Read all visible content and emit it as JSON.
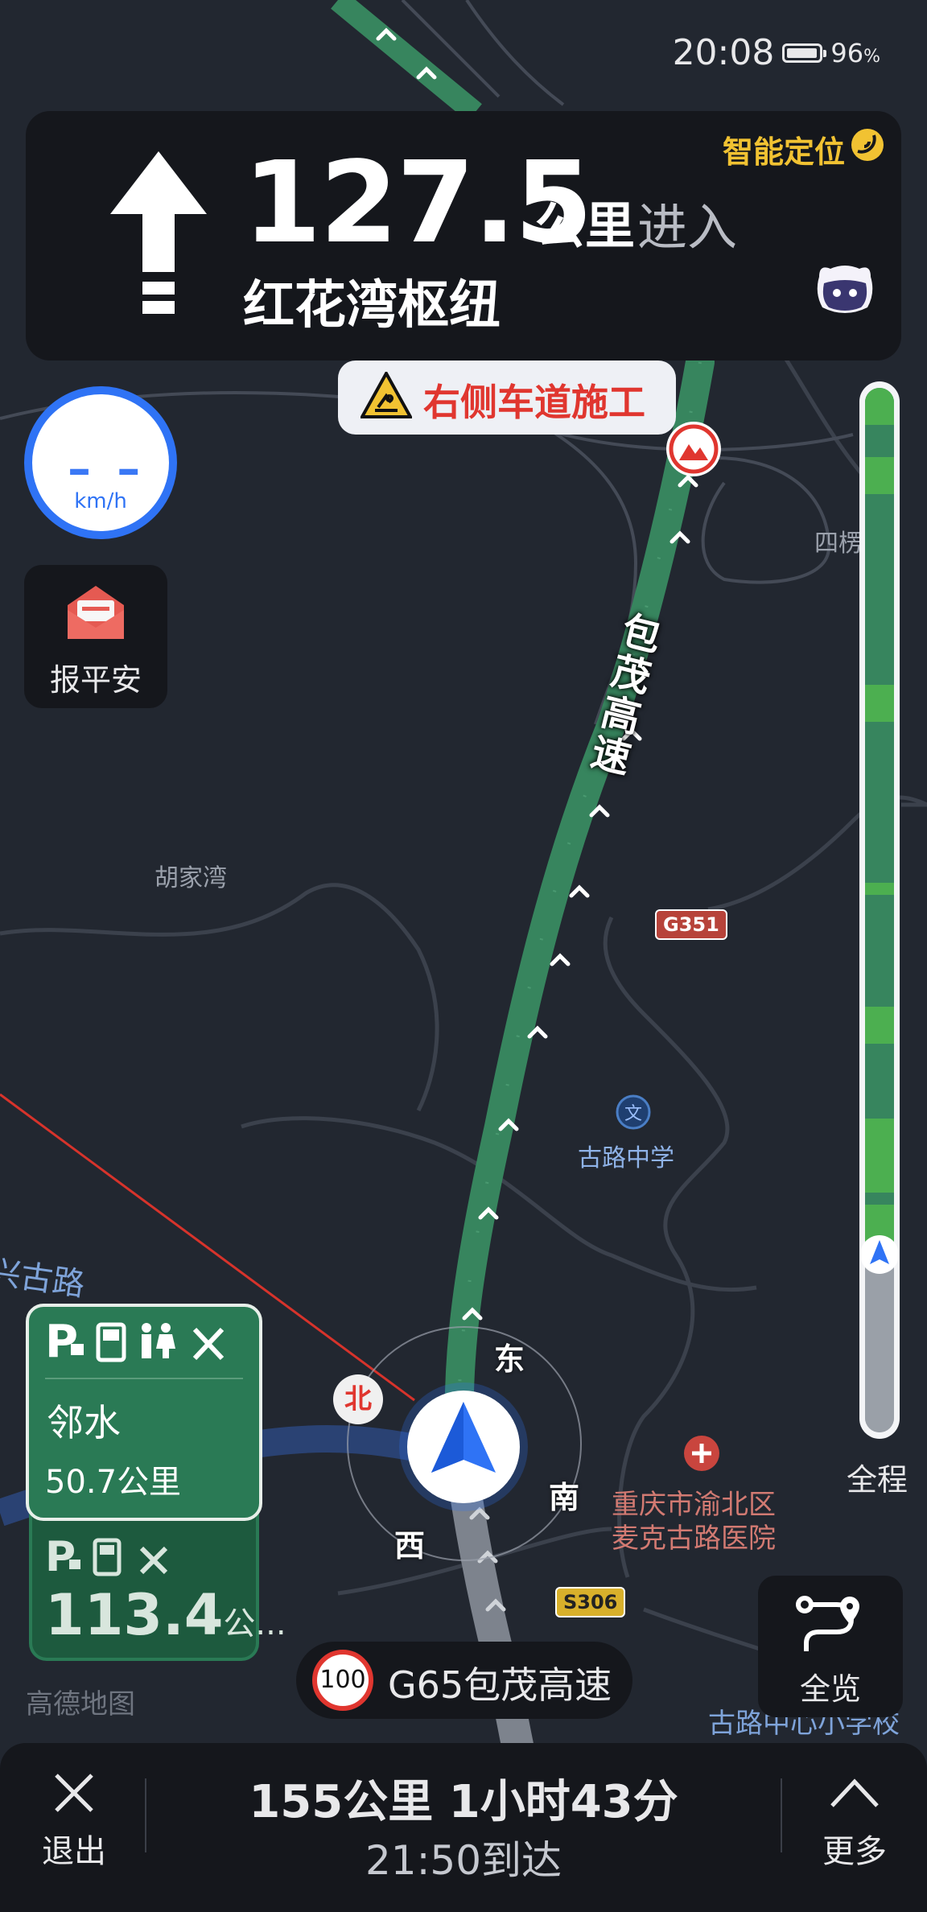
{
  "status_bar": {
    "time": "20:08",
    "battery_percent": "96",
    "battery_unit": "%",
    "battery_level": 0.96
  },
  "guidance": {
    "distance": "127.5",
    "distance_unit": "公里",
    "action": "进入",
    "road": "红花湾枢纽",
    "smart_location": "智能定位",
    "maneuver_icon": "straight-arrow-icon"
  },
  "warning": {
    "text": "右侧车道施工",
    "icon": "construction-icon"
  },
  "speedometer": {
    "value": "– –",
    "unit": "km/h"
  },
  "safety_button": {
    "label": "报平安",
    "icon": "envelope-icon"
  },
  "progress": {
    "label": "全程",
    "traveled_fraction": 0.17,
    "colors": {
      "smooth": "#4caf50",
      "fast": "#37855e",
      "traveled": "#9aa0a8"
    }
  },
  "service_areas": [
    {
      "name": "邻水",
      "distance": "50.7",
      "unit": "公里",
      "icons": [
        "parking-icon",
        "fuel-icon",
        "restroom-icon",
        "repair-icon"
      ]
    },
    {
      "distance": "113.4",
      "unit": "公...",
      "icons": [
        "parking-icon",
        "fuel-icon",
        "repair-icon"
      ]
    }
  ],
  "brand": "高德地图",
  "overview_button": {
    "label": "全览",
    "icon": "route-icon"
  },
  "current_road": {
    "speed_limit": "100",
    "name": "G65包茂高速"
  },
  "bottom_bar": {
    "exit_label": "退出",
    "more_label": "更多",
    "summary": "155公里 1小时43分",
    "eta": "21:50到达"
  },
  "map": {
    "highway_label": "包茂高速",
    "places": [
      "胡家湾",
      "古路中学",
      "重庆市渝北区",
      "麦克古路医院",
      "古路中心小学校",
      "四楞",
      "兴古路"
    ],
    "shields": [
      "G351",
      "S306"
    ],
    "compass": {
      "north": "北",
      "east": "东",
      "south": "南",
      "west": "西"
    }
  },
  "colors": {
    "route": "#37855e",
    "brand_blue": "#2f73f5",
    "warning_red": "#e0362f",
    "smart_gold": "#f1c232"
  }
}
